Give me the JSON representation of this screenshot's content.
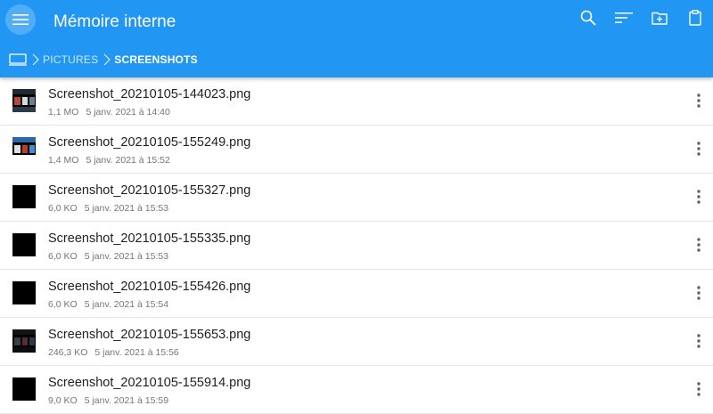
{
  "header": {
    "title": "Mémoire interne",
    "icons": [
      "menu-icon",
      "search-icon",
      "sort-icon",
      "new-folder-icon",
      "clipboard-icon"
    ]
  },
  "breadcrumb": {
    "items": [
      {
        "icon": "device-icon"
      },
      {
        "label": "PICTURES"
      },
      {
        "label": "SCREENSHOTS"
      }
    ]
  },
  "colors": {
    "app_bar": "#2196f3",
    "text_primary": "#212121",
    "text_secondary": "#757575",
    "divider": "#e6e6e6"
  },
  "files": [
    {
      "name": "Screenshot_20210105-144023.png",
      "size": "1,1 MO",
      "date": "5 janv. 2021 à 14:40",
      "thumb": "mixed"
    },
    {
      "name": "Screenshot_20210105-155249.png",
      "size": "1,4 MO",
      "date": "5 janv. 2021 à 15:52",
      "thumb": "mixed2"
    },
    {
      "name": "Screenshot_20210105-155327.png",
      "size": "6,0 KO",
      "date": "5 janv. 2021 à 15:53",
      "thumb": "black"
    },
    {
      "name": "Screenshot_20210105-155335.png",
      "size": "6,0 KO",
      "date": "5 janv. 2021 à 15:53",
      "thumb": "black"
    },
    {
      "name": "Screenshot_20210105-155426.png",
      "size": "6,0 KO",
      "date": "5 janv. 2021 à 15:54",
      "thumb": "black"
    },
    {
      "name": "Screenshot_20210105-155653.png",
      "size": "246,3 KO",
      "date": "5 janv. 2021 à 15:56",
      "thumb": "darkish"
    },
    {
      "name": "Screenshot_20210105-155914.png",
      "size": "9,0 KO",
      "date": "5 janv. 2021 à 15:59",
      "thumb": "black"
    }
  ]
}
